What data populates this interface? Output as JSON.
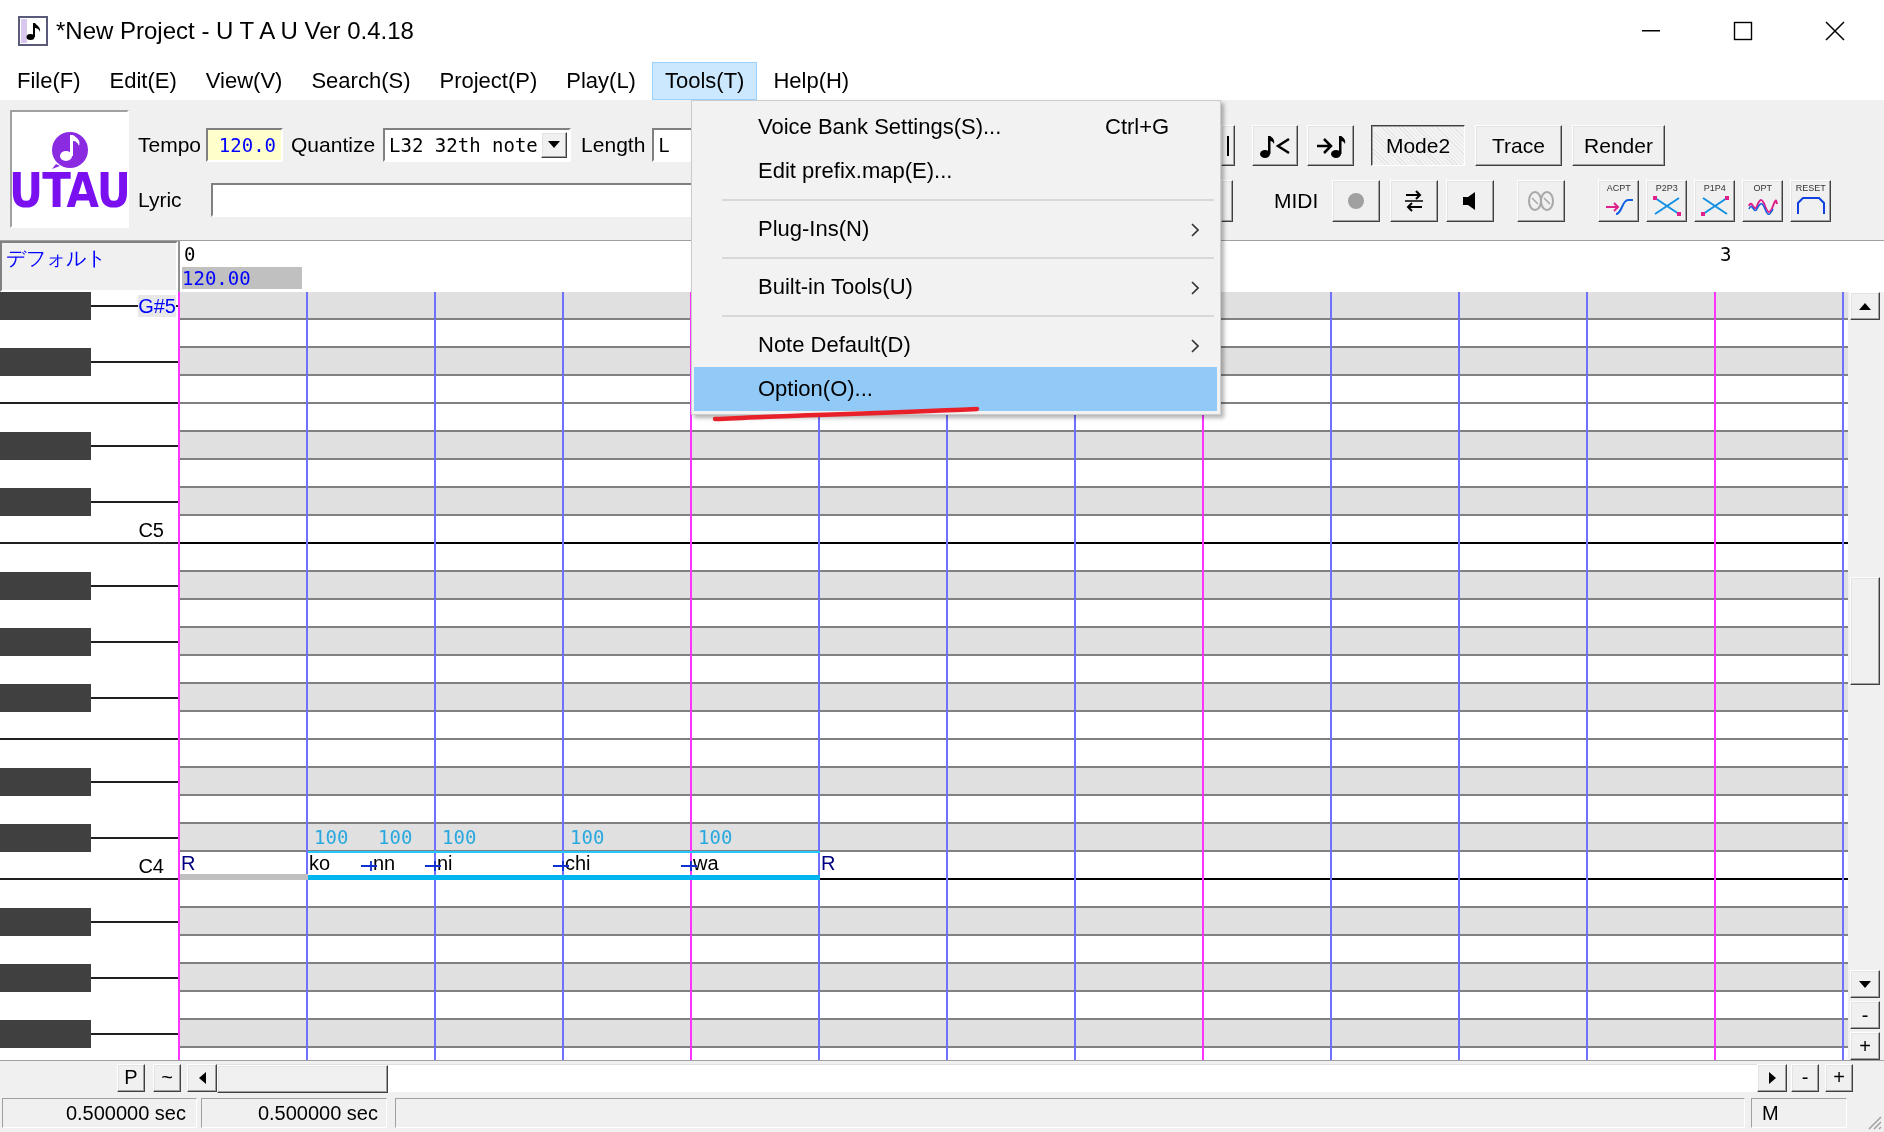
{
  "window": {
    "title": "*New Project - U T A U Ver 0.4.18"
  },
  "menu_bar": [
    {
      "label": "File(F)",
      "selected": false
    },
    {
      "label": "Edit(E)",
      "selected": false
    },
    {
      "label": "View(V)",
      "selected": false
    },
    {
      "label": "Search(S)",
      "selected": false
    },
    {
      "label": "Project(P)",
      "selected": false
    },
    {
      "label": "Play(L)",
      "selected": false
    },
    {
      "label": "Tools(T)",
      "selected": true
    },
    {
      "label": "Help(H)",
      "selected": false
    }
  ],
  "tools_menu": {
    "items": [
      {
        "kind": "command",
        "label": "Voice Bank Settings(S)...",
        "shortcut": "Ctrl+G",
        "selected": false
      },
      {
        "kind": "command",
        "label": "Edit prefix.map(E)...",
        "selected": false
      },
      {
        "kind": "separator"
      },
      {
        "kind": "submenu",
        "label": "Plug-Ins(N)",
        "selected": false
      },
      {
        "kind": "separator"
      },
      {
        "kind": "submenu",
        "label": "Built-in Tools(U)",
        "selected": false
      },
      {
        "kind": "separator"
      },
      {
        "kind": "submenu",
        "label": "Note Default(D)",
        "selected": false
      },
      {
        "kind": "command",
        "label": "Option(O)...",
        "selected": true
      }
    ]
  },
  "toolbar": {
    "logo": "UTAU",
    "tempo_label": "Tempo",
    "tempo": "120.0",
    "quantize_label": "Quantize",
    "quantize": "L32 32th note",
    "length_label": "Length",
    "length": "L",
    "lyric_label": "Lyric",
    "mode_buttons": [
      {
        "label": "Mode2",
        "pressed": true
      },
      {
        "label": "Trace",
        "pressed": false
      },
      {
        "label": "Render",
        "pressed": false
      }
    ],
    "midi_label": "MIDI",
    "tool_buttons": [
      {
        "label": "ACPT"
      },
      {
        "label": "P2P3"
      },
      {
        "label": "P1P4"
      },
      {
        "label": "OPT"
      },
      {
        "label": "RESET"
      }
    ]
  },
  "ruler": {
    "track_name": "デフォルト",
    "tempo_mark": "120.00",
    "measures": [
      {
        "label": "0",
        "kind": "first"
      },
      {
        "label": "3",
        "kind": "fourth"
      }
    ]
  },
  "piano_roll": {
    "rows": [
      {
        "kind": "black",
        "octave_start": false,
        "label": "G#5",
        "label_highlighted": true
      },
      {
        "kind": "white",
        "octave_start": false
      },
      {
        "kind": "black",
        "octave_start": false
      },
      {
        "kind": "white",
        "octave_start": false
      },
      {
        "kind": "white",
        "octave_start": false
      },
      {
        "kind": "black",
        "octave_start": false
      },
      {
        "kind": "white",
        "octave_start": false
      },
      {
        "kind": "black",
        "octave_start": false
      },
      {
        "kind": "white",
        "octave_start": true,
        "label": "C5",
        "label_highlighted": false
      },
      {
        "kind": "white",
        "octave_start": false
      },
      {
        "kind": "black",
        "octave_start": false
      },
      {
        "kind": "white",
        "octave_start": false
      },
      {
        "kind": "black",
        "octave_start": false
      },
      {
        "kind": "white",
        "octave_start": false
      },
      {
        "kind": "black",
        "octave_start": false
      },
      {
        "kind": "white",
        "octave_start": false
      },
      {
        "kind": "white",
        "octave_start": false
      },
      {
        "kind": "black",
        "octave_start": false
      },
      {
        "kind": "white",
        "octave_start": false
      },
      {
        "kind": "black",
        "octave_start": false
      },
      {
        "kind": "white",
        "octave_start": true,
        "label": "C4",
        "label_highlighted": false,
        "notes": [
          {
            "kind": "rest",
            "lyric": "R",
            "short": false,
            "bar": true
          },
          {
            "kind": "note",
            "lyric": "ko",
            "velocity": "100",
            "short": true
          },
          {
            "kind": "note",
            "lyric": "nn",
            "velocity": "100",
            "short": true
          },
          {
            "kind": "note",
            "lyric": "ni",
            "velocity": "100",
            "short": false
          },
          {
            "kind": "note",
            "lyric": "chi",
            "velocity": "100",
            "short": false
          },
          {
            "kind": "note",
            "lyric": "wa",
            "velocity": "100",
            "short": false
          },
          {
            "kind": "rest",
            "lyric": "R",
            "short": false,
            "bar": false
          }
        ]
      },
      {
        "kind": "white",
        "octave_start": false
      },
      {
        "kind": "black",
        "octave_start": false
      },
      {
        "kind": "white",
        "octave_start": false
      },
      {
        "kind": "black",
        "octave_start": false
      },
      {
        "kind": "white",
        "octave_start": false
      },
      {
        "kind": "black",
        "octave_start": false
      },
      {
        "kind": "white"
      }
    ]
  },
  "vertical_scrollbar": {
    "zoom_buttons": [
      "-",
      "+"
    ]
  },
  "horizontal_bar": {
    "buttons": [
      "P",
      "~"
    ],
    "zoom_buttons": [
      "-",
      "+"
    ]
  },
  "status_bar": {
    "position": "0.500000 sec",
    "length": "0.500000 sec",
    "mode": "M"
  }
}
